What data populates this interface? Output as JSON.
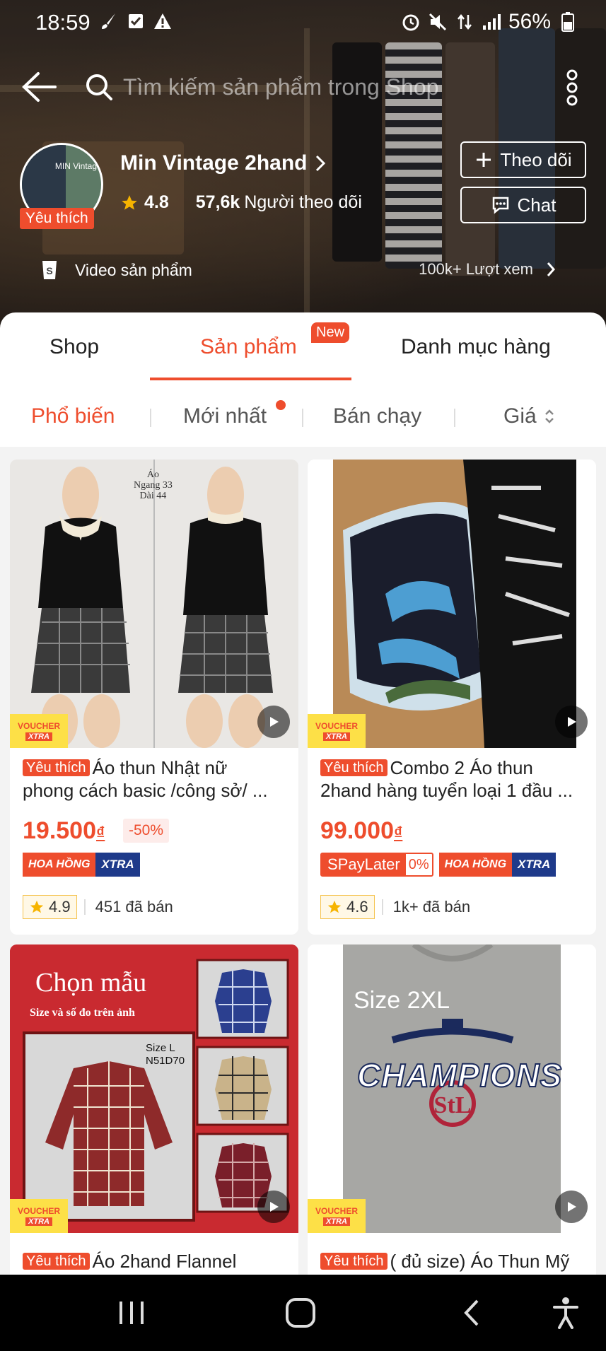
{
  "status": {
    "time": "18:59",
    "battery": "56%"
  },
  "search": {
    "placeholder": "Tìm kiếm sản phẩm trong Shop"
  },
  "shop": {
    "avatar_text": "MIN Vintag",
    "badge": "Yêu thích",
    "name": "Min Vintage 2hand",
    "rating": "4.8",
    "followers_count": "57,6k",
    "followers_label": "Người theo dõi",
    "follow_button": "Theo dõi",
    "chat_button": "Chat",
    "video_label": "Video sản phẩm",
    "views": "100k+ Lượt xem"
  },
  "tabs": [
    {
      "label": "Shop",
      "active": false
    },
    {
      "label": "Sản phẩm",
      "active": true,
      "badge": "New"
    },
    {
      "label": "Danh mục hàng",
      "active": false
    }
  ],
  "sort": [
    {
      "label": "Phổ biến",
      "active": true
    },
    {
      "label": "Mới nhất",
      "active": false
    },
    {
      "label": "Bán chạy",
      "active": false
    },
    {
      "label": "Giá",
      "active": false
    }
  ],
  "voucher": {
    "line1": "VOUCHER",
    "line2": "XTRA"
  },
  "tag_hoahong": {
    "a": "HOA HỒNG",
    "b": "XTRA"
  },
  "products": [
    {
      "badge": "Yêu thích",
      "title_line1": "Áo thun Nhật nữ",
      "title_line2": "phong cách basic /công sở/ ...",
      "price": "19.500",
      "currency": "₫",
      "discount": "-50%",
      "rating": "4.9",
      "sold": "451 đã bán",
      "image_text": "Áo\nNgang 33\nDài 44"
    },
    {
      "badge": "Yêu thích",
      "title_line1": "Combo 2 Áo thun",
      "title_line2": "2hand hàng tuyển loại 1 đầu ...",
      "price": "99.000",
      "currency": "₫",
      "spaylater": "SPayLater",
      "spaylater_pct": "0%",
      "rating": "4.6",
      "sold": "1k+ đã bán"
    },
    {
      "badge": "Yêu thích",
      "title_line1": "Áo 2hand Flannel",
      "image_title": "Chọn mẫu",
      "image_subtitle": "Size và số đo trên ảnh",
      "image_size": "Size L",
      "image_code": "N51D70"
    },
    {
      "badge": "Yêu thích",
      "title_line1": "( đủ size) Áo Thun Mỹ",
      "image_size": "Size 2XL",
      "image_print": "CHAMPIONS"
    }
  ],
  "colors": {
    "accent": "#ee4d2d",
    "voucher_yellow": "#fde047",
    "xtra_blue": "#1e3a8a"
  }
}
